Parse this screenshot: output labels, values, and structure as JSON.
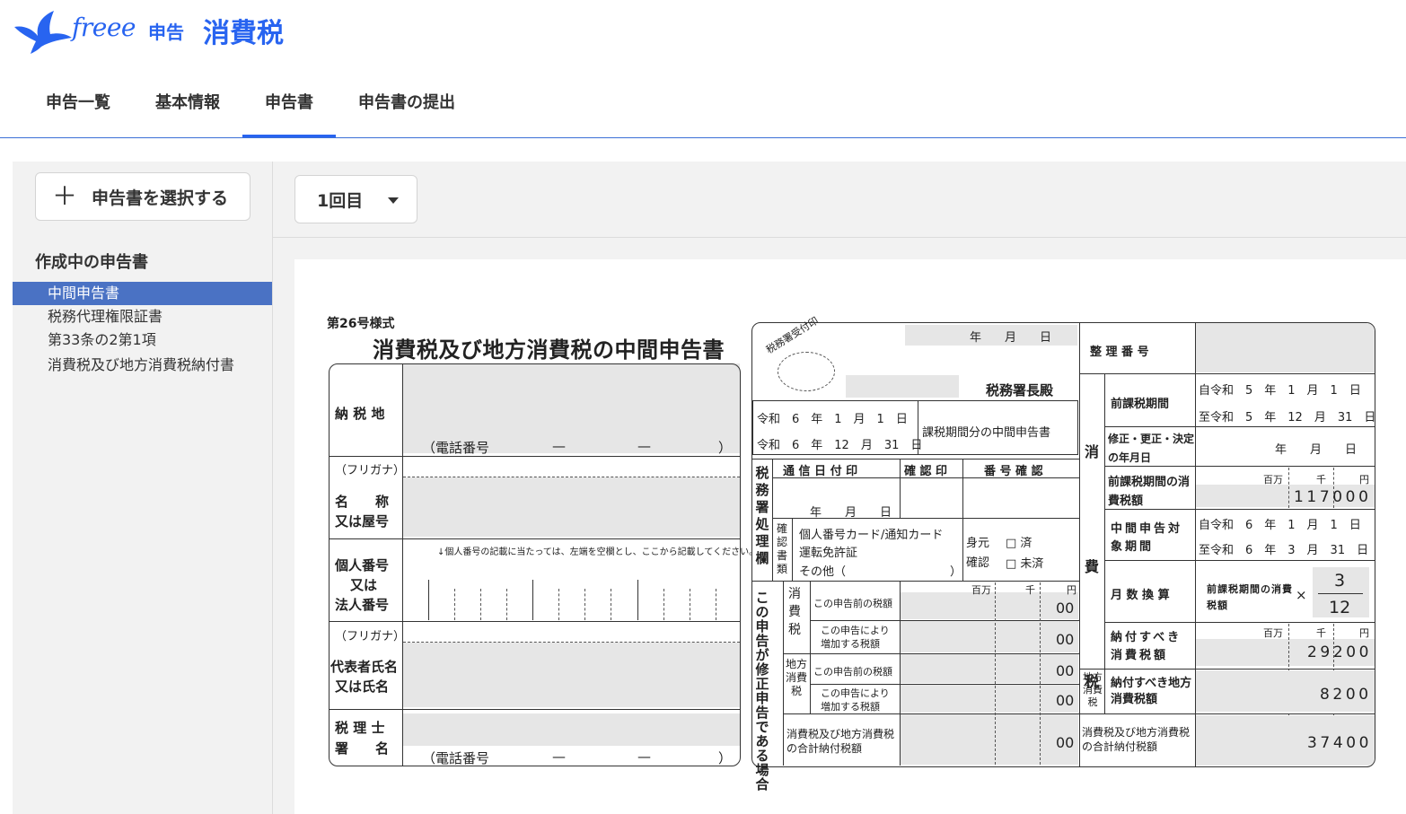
{
  "header": {
    "logo_text": "freee",
    "logo_product": "申告",
    "app_title": "消費税",
    "brand_color": "#2864f0",
    "logo_icon": "bird-wing-icon"
  },
  "tabs": [
    {
      "label": "申告一覧",
      "active": false
    },
    {
      "label": "基本情報",
      "active": false
    },
    {
      "label": "申告書",
      "active": true
    },
    {
      "label": "申告書の提出",
      "active": false
    }
  ],
  "sidebar": {
    "select_button": "申告書を選択する",
    "heading": "作成中の申告書",
    "items": [
      {
        "label": "中間申告書",
        "active": true
      },
      {
        "label": "税務代理権限証書",
        "active": false
      },
      {
        "label": "第33条の2第1項",
        "active": false
      },
      {
        "label": "消費税及び地方消費税納付書",
        "active": false
      }
    ]
  },
  "toolbar": {
    "round_select": "1回目"
  },
  "form": {
    "form_no": "第26号様式",
    "title": "消費税及び地方消費税の中間申告書",
    "left": {
      "nozeichi": "納 税 地",
      "tel": "（電話番号",
      "dash": "—",
      "close_paren": "）",
      "furigana": "（フリガナ）",
      "meisho_1": "名　　称",
      "meisho_2": "又は屋号",
      "kojin_1": "個人番号",
      "kojin_2": "又は",
      "kojin_3": "法人番号",
      "kojin_note": "↓個人番号の記載に当たっては、左端を空欄とし、ここから記載してください。",
      "daihyo_1": "代表者氏名",
      "daihyo_2": "又は氏名",
      "zeirishi_1": "税 理 士",
      "zeirishi_2": "署　　名"
    },
    "center": {
      "stamp": "税務署受付印",
      "ymd": "年　　月　　日",
      "chief": "税務署長殿",
      "period_from": "令和　6　年　1　月　1　日",
      "period_to": "令和　6　年　12　月　31　日",
      "period_label": "課税期間分の中間申告書",
      "office_col": "税務署処理欄",
      "tsushin": "通 信 日 付 印",
      "kakunin_in": "確 認 印",
      "bango_kakunin": "番 号 確 認",
      "ymd2": "年　　月　　日",
      "kakunin_shorui": "確認書類",
      "doc1": "個人番号カード/通知カード",
      "doc2": "運転免許証",
      "doc3": "その他（",
      "doc3_close": "）",
      "mimoto": "身元確認",
      "check1": "□ 済",
      "check2": "□ 未済",
      "shusei_col": "この申告が修正申告である場合",
      "shohizei_col": "消費税",
      "chiho_col": "地方消費税",
      "row1": "この申告前の税額",
      "row2": "この申告により増加する税額",
      "row3": "この申告前の税額",
      "row4": "この申告により増加する税額",
      "row5": "消費税及び地方消費税の合計納付税額",
      "unit_m": "百万",
      "unit_k": "千",
      "unit_y": "円",
      "zero": "00"
    },
    "right": {
      "seiri": "整 理 番 号",
      "shohizei_col": "消費税",
      "zenki_period": "前課税期間",
      "zenki_from": "自令和　5　年　1　月　1　日",
      "zenki_to": "至令和　5　年　12　月　31　日",
      "shusei_label": "修正・更正・決定の年月日",
      "ymd": "年　　月　　日",
      "zenki_tax_label": "前課税期間の消費税額",
      "zenki_tax": "117000",
      "chukan_label": "中間申告対象期間",
      "chukan_from": "自令和　6　年　1　月　1　日",
      "chukan_to": "至令和　6　年　3　月　31　日",
      "getsu_label": "月 数 換 算",
      "getsu_formula": "前課税期間の消費税額",
      "times": "×",
      "numerator": "3",
      "denominator": "12",
      "nofu_label": "納付すべき消費税額",
      "nofu_tax": "29200",
      "chiho_col": "地方消費税",
      "chiho_label": "納付すべき地方消費税額",
      "chiho_tax": "8200",
      "total_label": "消費税及び地方消費税の合計納付税額",
      "total_tax": "37400",
      "unit_m": "百万",
      "unit_k": "千",
      "unit_y": "円"
    }
  }
}
